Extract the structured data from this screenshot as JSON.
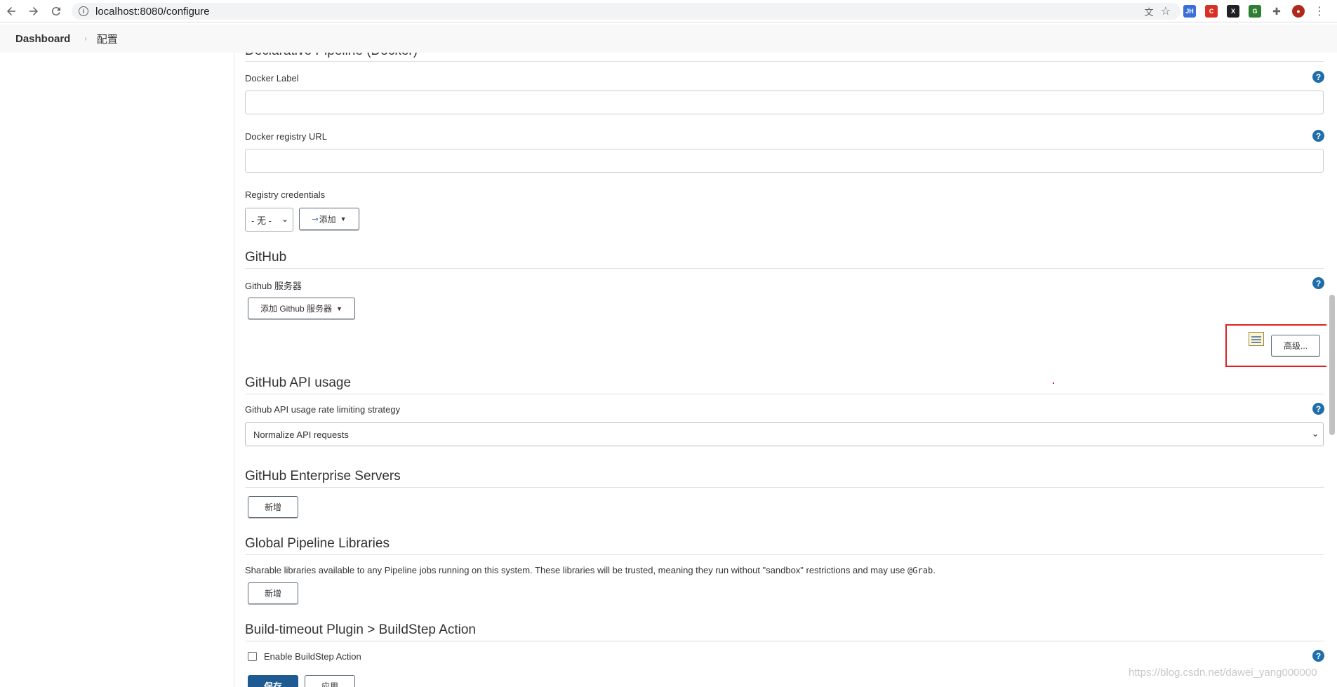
{
  "browser": {
    "url": "localhost:8080/configure",
    "extensions": [
      {
        "name": "translate-icon",
        "label": "",
        "color": "#5f6368"
      },
      {
        "name": "jh-extension-icon",
        "label": "JH",
        "color": "#3a6fd8"
      },
      {
        "name": "red-extension-icon",
        "label": "C",
        "color": "#d93025"
      },
      {
        "name": "x-extension-icon",
        "label": "X",
        "color": "#202124"
      },
      {
        "name": "green-extension-icon",
        "label": "G",
        "color": "#2e7d32"
      },
      {
        "name": "puzzle-icon",
        "label": "",
        "color": "#5f6368"
      }
    ]
  },
  "breadcrumb": {
    "dashboard": "Dashboard",
    "current": "配置"
  },
  "declarative": {
    "title_partial": "Declarative Pipeline (Docker)",
    "docker_label": "Docker Label",
    "registry_url": "Docker registry URL",
    "registry_credentials": "Registry credentials",
    "credentials_selected": "- 无 -",
    "add_button": "添加"
  },
  "github": {
    "title": "GitHub",
    "servers_label": "Github 服务器",
    "add_server_button": "添加 Github 服务器",
    "advanced_button": "高级..."
  },
  "github_api": {
    "title": "GitHub API usage",
    "strategy_label": "Github API usage rate limiting strategy",
    "strategy_selected": "Normalize API requests"
  },
  "enterprise": {
    "title": "GitHub Enterprise Servers",
    "add_button": "新增"
  },
  "libraries": {
    "title": "Global Pipeline Libraries",
    "description": "Sharable libraries available to any Pipeline jobs running on this system. These libraries will be trusted, meaning they run without \"sandbox\" restrictions and may use",
    "description_code": "@Grab",
    "description_end": ".",
    "add_button": "新增"
  },
  "build_timeout": {
    "title": "Build-timeout Plugin > BuildStep Action",
    "checkbox_label": "Enable BuildStep Action"
  },
  "footer": {
    "save": "保存",
    "apply": "应用"
  },
  "watermark": "https://blog.csdn.net/dawei_yang000000"
}
